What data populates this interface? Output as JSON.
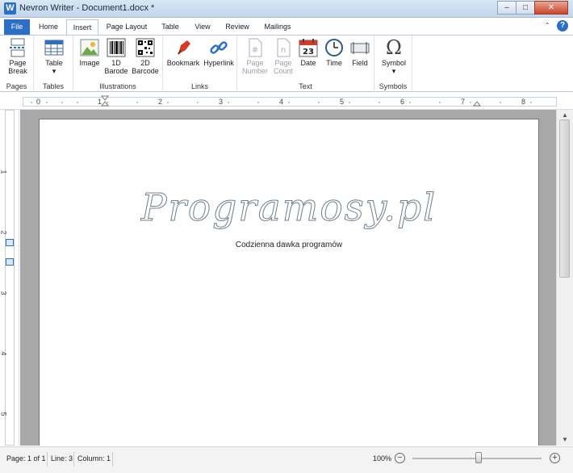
{
  "window": {
    "app_icon": "W",
    "title": "Nevron Writer - Document1.docx *",
    "controls": {
      "minimize": "–",
      "maximize": "□",
      "close": "✕"
    }
  },
  "tabs": [
    "File",
    "Home",
    "Insert",
    "Page Layout",
    "Table",
    "View",
    "Review",
    "Mailings"
  ],
  "active_tab": "Insert",
  "ribbon": {
    "pages": {
      "label": "Pages",
      "page_break_line1": "Page",
      "page_break_line2": "Break"
    },
    "tables": {
      "label": "Tables",
      "table": "Table"
    },
    "illustrations": {
      "label": "Illustrations",
      "image": "Image",
      "barcode1d_line1": "1D",
      "barcode1d_line2": "Barode",
      "barcode2d_line1": "2D",
      "barcode2d_line2": "Barcode"
    },
    "links": {
      "label": "Links",
      "bookmark": "Bookmark",
      "hyperlink": "Hyperlink"
    },
    "text": {
      "label": "Text",
      "page_number_line1": "Page",
      "page_number_line2": "Number",
      "page_count_line1": "Page",
      "page_count_line2": "Count",
      "date": "Date",
      "date_icon_text": "23",
      "time": "Time",
      "field": "Field"
    },
    "symbols": {
      "label": "Symbols",
      "symbol": "Symbol",
      "symbol_glyph": "Ω"
    }
  },
  "ruler": {
    "h_numbers": [
      "0",
      "1",
      "2",
      "3",
      "4",
      "5",
      "6",
      "7",
      "8"
    ],
    "v_numbers": [
      "1",
      "2",
      "3",
      "4",
      "5"
    ]
  },
  "document": {
    "title": "Programosy.pl",
    "subtitle": "Codzienna dawka programów"
  },
  "status": {
    "page": "Page: 1 of 1",
    "line": "Line: 3",
    "column": "Column: 1",
    "zoom": "100%",
    "zoom_level": 1.0
  },
  "colors": {
    "accent": "#2b6fc6",
    "canvas": "#a8a8a8",
    "bookmark": "#d23a2a",
    "hyperlink": "#2b6fc6"
  },
  "icons": {
    "page_break": "page-break-icon",
    "table": "table-icon",
    "image": "image-icon",
    "barcode1d": "barcode-1d-icon",
    "barcode2d": "qr-code-icon",
    "bookmark": "bookmark-icon",
    "hyperlink": "hyperlink-icon",
    "page_number": "page-number-icon",
    "page_count": "page-count-icon",
    "date": "calendar-icon",
    "time": "clock-icon",
    "field": "field-icon",
    "symbol": "omega-icon"
  }
}
